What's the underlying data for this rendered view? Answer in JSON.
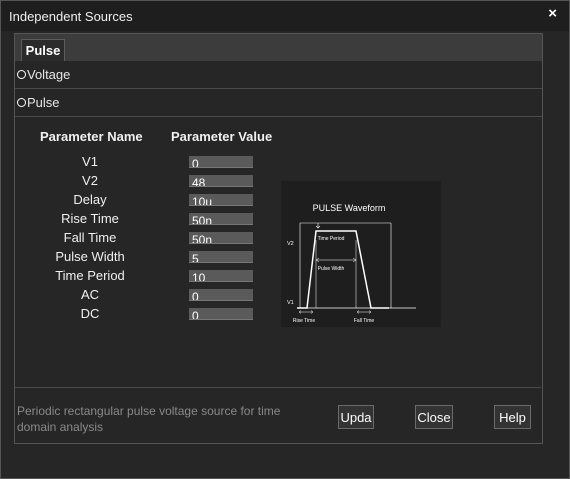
{
  "window": {
    "title": "Independent Sources",
    "close_glyph": "×"
  },
  "tabs": [
    {
      "label": "Pulse",
      "selected": true
    }
  ],
  "source_types": [
    {
      "label": "Voltage"
    },
    {
      "label": "Pulse"
    }
  ],
  "table": {
    "name_header": "Parameter Name",
    "value_header": "Parameter Value",
    "params": [
      {
        "name": "V1",
        "value": "0"
      },
      {
        "name": "V2",
        "value": "48"
      },
      {
        "name": "Delay",
        "value": "10u"
      },
      {
        "name": "Rise Time",
        "value": "50n"
      },
      {
        "name": "Fall Time",
        "value": "50n"
      },
      {
        "name": "Pulse Width",
        "value": "5"
      },
      {
        "name": "Time Period",
        "value": "10"
      },
      {
        "name": "AC",
        "value": "0"
      },
      {
        "name": "DC",
        "value": "0"
      }
    ]
  },
  "waveform": {
    "title": "PULSE Waveform",
    "v1": "V1",
    "v2": "V2",
    "time_period": "Time Period",
    "pulse_width": "Pulse Width",
    "rise_time": "Rise Time",
    "fall_time": "Fall Time"
  },
  "footer": {
    "description": "Periodic rectangular pulse voltage source for time domain analysis",
    "update_label": "Upda",
    "close_label": "Close",
    "help_label": "Help"
  }
}
